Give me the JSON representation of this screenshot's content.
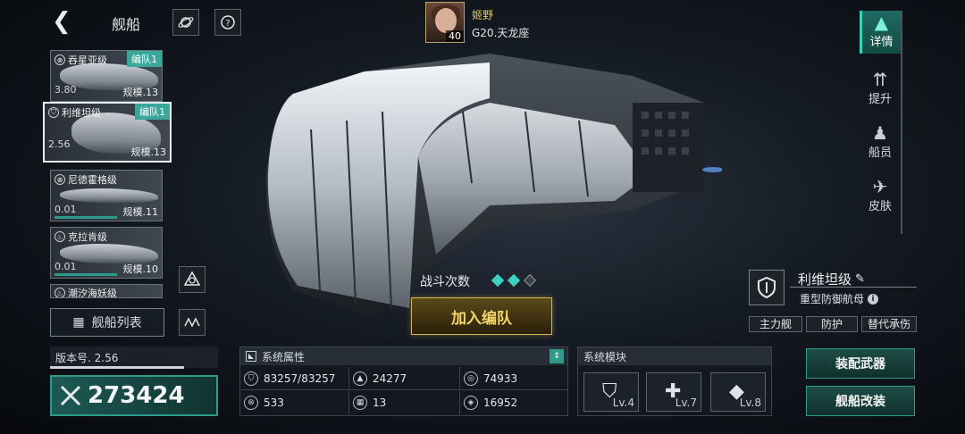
{
  "header": {
    "back_glyph": "❮",
    "title": "舰船"
  },
  "top_icons": [
    {
      "name": "planet-icon",
      "glyph": "🪐"
    },
    {
      "name": "help-icon",
      "glyph": "?"
    }
  ],
  "pilot": {
    "name": "姬野",
    "level": "40",
    "location": "G20.天龙座"
  },
  "ship_list": [
    {
      "name": "吞星亚级",
      "fleet": "编队1",
      "level": "3.80",
      "scale": "规模.13",
      "selected": false
    },
    {
      "name": "利维坦级",
      "fleet": "编队1",
      "level": "2.56",
      "scale": "规模.13",
      "selected": true
    },
    {
      "name": "尼德霍格级",
      "fleet": "",
      "level": "0.01",
      "scale": "规模.11",
      "selected": false
    },
    {
      "name": "克拉肯级",
      "fleet": "",
      "level": "0.01",
      "scale": "规模.10",
      "selected": false
    },
    {
      "name": "潮汐海妖级",
      "fleet": "",
      "level": "",
      "scale": "",
      "selected": false
    }
  ],
  "list_button": "舰船列表",
  "version": {
    "label": "版本号. 2.56"
  },
  "power": {
    "value": "273424"
  },
  "side_menu": [
    {
      "label": "详情",
      "active": true
    },
    {
      "label": "提升",
      "active": false
    },
    {
      "label": "船员",
      "active": false
    },
    {
      "label": "皮肤",
      "active": false
    }
  ],
  "ship_info": {
    "name": "利维坦级",
    "class": "重型防御航母",
    "tags": [
      "主力舰",
      "防护",
      "替代承伤"
    ]
  },
  "battle": {
    "label": "战斗次数",
    "filled": 2,
    "total": 3
  },
  "join_button": "加入编队",
  "attributes": {
    "title": "系统属性",
    "items": [
      {
        "icon": "hull-icon",
        "value": "83257/83257"
      },
      {
        "icon": "attack-icon",
        "value": "24277"
      },
      {
        "icon": "armor-icon",
        "value": "74933"
      },
      {
        "icon": "shield-stat-icon",
        "value": "533"
      },
      {
        "icon": "grid-icon",
        "value": "13"
      },
      {
        "icon": "speed-icon",
        "value": "16952"
      }
    ]
  },
  "modules": {
    "title": "系统模块",
    "items": [
      {
        "icon": "shield-module-icon",
        "level": "Lv.4"
      },
      {
        "icon": "cross-shield-module-icon",
        "level": "Lv.7"
      },
      {
        "icon": "diamond-grid-module-icon",
        "level": "Lv.8"
      }
    ]
  },
  "actions": {
    "weapons": "装配武器",
    "modify": "舰船改装"
  },
  "colors": {
    "accent": "#3ad2bf",
    "gold": "#d6b650",
    "teal": "#2d9a8c"
  }
}
